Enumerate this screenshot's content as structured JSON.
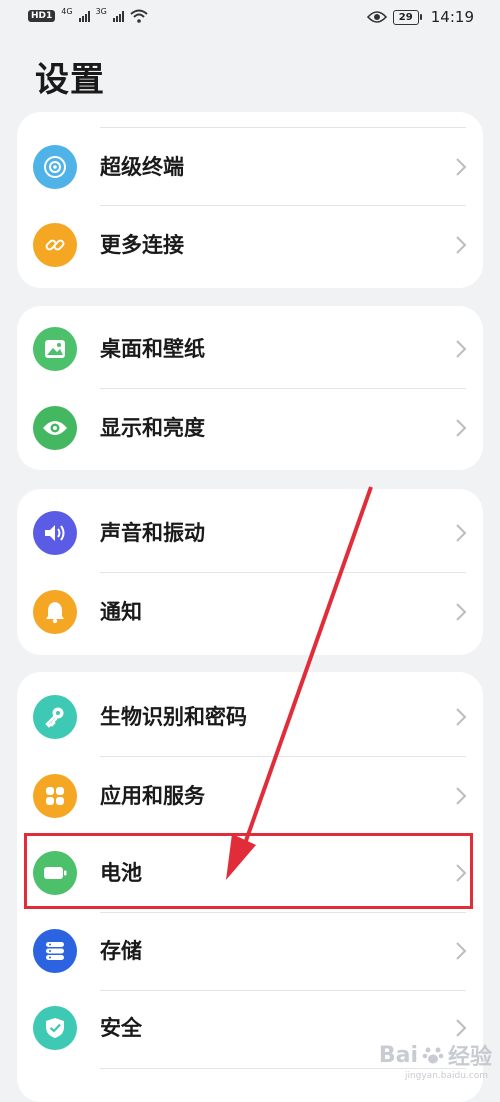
{
  "status_bar": {
    "hd": "HD",
    "sim": "1",
    "net1": "4G",
    "net2": "3G",
    "battery": "29",
    "time": "14:19"
  },
  "title": "设置",
  "groups": [
    {
      "items": [
        {
          "label": "超级终端",
          "icon": "super-device-icon",
          "color": "#4fb3e8"
        },
        {
          "label": "更多连接",
          "icon": "link-icon",
          "color": "#f5a623"
        }
      ]
    },
    {
      "items": [
        {
          "label": "桌面和壁纸",
          "icon": "wallpaper-icon",
          "color": "#4cc06a"
        },
        {
          "label": "显示和亮度",
          "icon": "eye-icon",
          "color": "#44b860"
        }
      ]
    },
    {
      "items": [
        {
          "label": "声音和振动",
          "icon": "speaker-icon",
          "color": "#5b5ce6"
        },
        {
          "label": "通知",
          "icon": "bell-icon",
          "color": "#f5a623"
        }
      ]
    },
    {
      "items": [
        {
          "label": "生物识别和密码",
          "icon": "key-icon",
          "color": "#3ec9b4"
        },
        {
          "label": "应用和服务",
          "icon": "apps-icon",
          "color": "#f5a623"
        },
        {
          "label": "电池",
          "icon": "battery-icon",
          "color": "#4cc06a"
        },
        {
          "label": "存储",
          "icon": "storage-icon",
          "color": "#2b63e0"
        },
        {
          "label": "安全",
          "icon": "shield-icon",
          "color": "#3ec9b4"
        }
      ]
    }
  ],
  "annotation": {
    "highlighted_item": "电池",
    "color": "#e12d3a"
  },
  "watermark": {
    "text": "Bai",
    "suffix": "经验",
    "sub": "jingyan.baidu.com"
  }
}
